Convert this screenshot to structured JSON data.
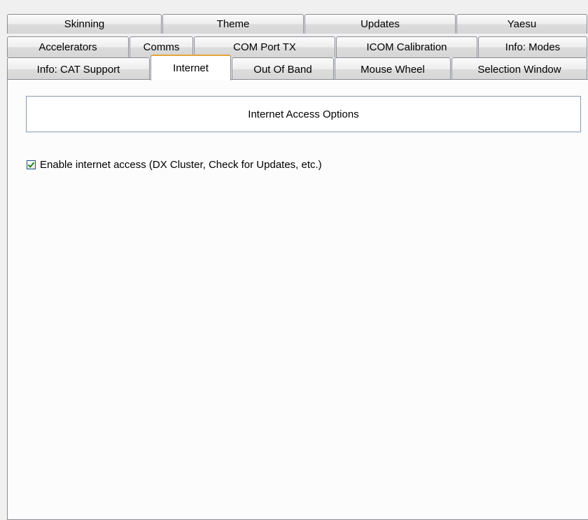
{
  "tab_rows": [
    [
      {
        "label": "Skinning",
        "name": "tab-skinning"
      },
      {
        "label": "Theme",
        "name": "tab-theme"
      },
      {
        "label": "Updates",
        "name": "tab-updates"
      },
      {
        "label": "Yaesu",
        "name": "tab-yaesu"
      }
    ],
    [
      {
        "label": "Accelerators",
        "name": "tab-accelerators"
      },
      {
        "label": "Comms",
        "name": "tab-comms"
      },
      {
        "label": "COM Port TX",
        "name": "tab-com-port-tx"
      },
      {
        "label": "ICOM Calibration",
        "name": "tab-icom-calibration"
      },
      {
        "label": "Info: Modes",
        "name": "tab-info-modes"
      }
    ],
    [
      {
        "label": "Info: CAT Support",
        "name": "tab-info-cat-support"
      },
      {
        "label": "Internet",
        "name": "tab-internet",
        "active": true
      },
      {
        "label": "Out Of Band",
        "name": "tab-out-of-band"
      },
      {
        "label": "Mouse Wheel",
        "name": "tab-mouse-wheel"
      },
      {
        "label": "Selection Window",
        "name": "tab-selection-window"
      }
    ]
  ],
  "panel": {
    "section_title": "Internet Access Options",
    "enable_checkbox": {
      "label": "Enable internet access (DX Cluster, Check for Updates, etc.)",
      "checked": true
    }
  },
  "colors": {
    "active_tab_accent": "#e8a33b",
    "checkmark": "#1f8a1f"
  }
}
